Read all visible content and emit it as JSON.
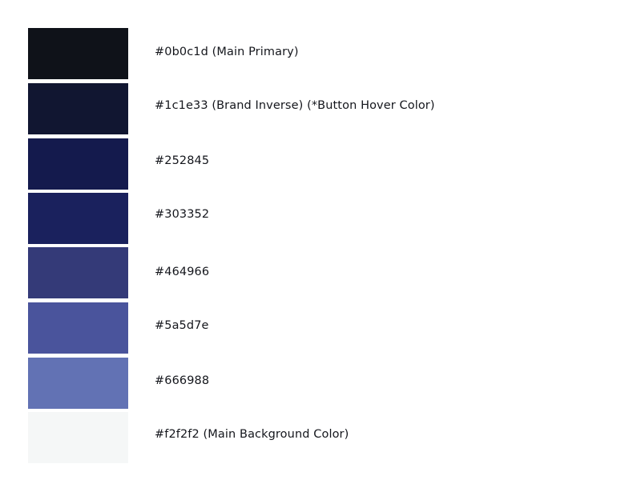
{
  "swatches": [
    {
      "color": "#0f1219",
      "label": "#0b0c1d (Main Primary)"
    },
    {
      "color": "#111631",
      "label": "#1c1e33 (Brand Inverse) (*Button Hover Color)"
    },
    {
      "color": "#141a4d",
      "label": "#252845"
    },
    {
      "color": "#1a215d",
      "label": "#303352"
    },
    {
      "color": "#343a78",
      "label": "#464966"
    },
    {
      "color": "#4a549c",
      "label": "#5a5d7e"
    },
    {
      "color": "#6272b4",
      "label": "#666988"
    },
    {
      "color": "#f5f7f7",
      "label": "#f2f2f2 (Main Background Color)"
    }
  ]
}
